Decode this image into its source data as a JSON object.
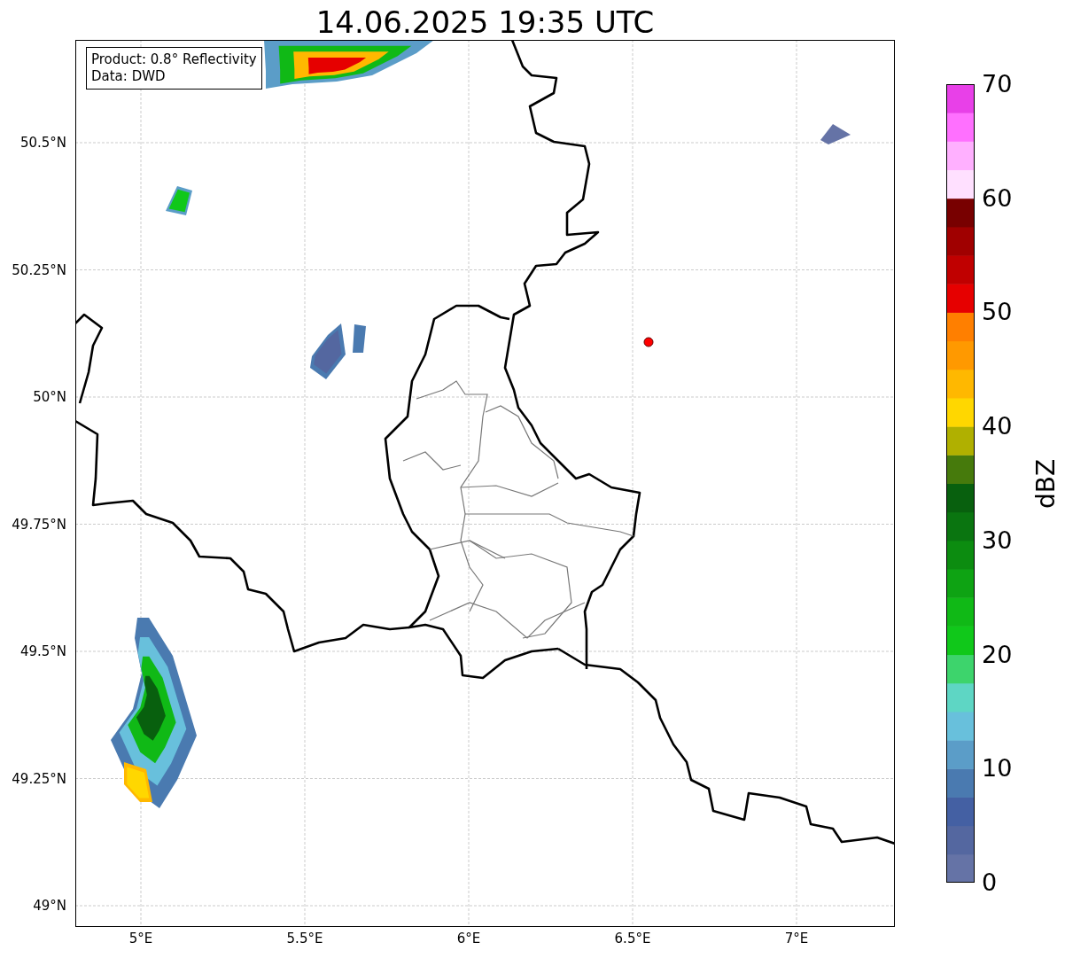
{
  "title": "14.06.2025 19:35 UTC",
  "info_box": [
    "Product: 0.8° Reflectivity",
    "Data: DWD"
  ],
  "map": {
    "y_ticks": [
      "50.5°N",
      "50.25°N",
      "50°N",
      "49.75°N",
      "49.5°N",
      "49.25°N",
      "49°N"
    ],
    "x_ticks": [
      "5°E",
      "5.5°E",
      "6°E",
      "6.5°E",
      "7°E"
    ]
  },
  "colorbar": {
    "label": "dBZ",
    "ticks": [
      "70",
      "60",
      "50",
      "40",
      "30",
      "20",
      "10",
      "0"
    ],
    "bands": [
      {
        "color": "#6573a6"
      },
      {
        "color": "#5467a0"
      },
      {
        "color": "#4460a3"
      },
      {
        "color": "#4a7ab0"
      },
      {
        "color": "#5b9dc8"
      },
      {
        "color": "#68c0dc"
      },
      {
        "color": "#5ed6c4"
      },
      {
        "color": "#3dd46c"
      },
      {
        "color": "#10c81a"
      },
      {
        "color": "#10b916"
      },
      {
        "color": "#0ea313"
      },
      {
        "color": "#0c8c10"
      },
      {
        "color": "#0a7510"
      },
      {
        "color": "#08600e"
      },
      {
        "color": "#467a0c"
      },
      {
        "color": "#b0b000"
      },
      {
        "color": "#ffd700"
      },
      {
        "color": "#ffb800"
      },
      {
        "color": "#ff9900"
      },
      {
        "color": "#ff7f00"
      },
      {
        "color": "#e60000"
      },
      {
        "color": "#c00000"
      },
      {
        "color": "#a00000"
      },
      {
        "color": "#780000"
      },
      {
        "color": "#ffe0ff"
      },
      {
        "color": "#ffb0ff"
      },
      {
        "color": "#ff70ff"
      },
      {
        "color": "#e840e8"
      }
    ]
  }
}
